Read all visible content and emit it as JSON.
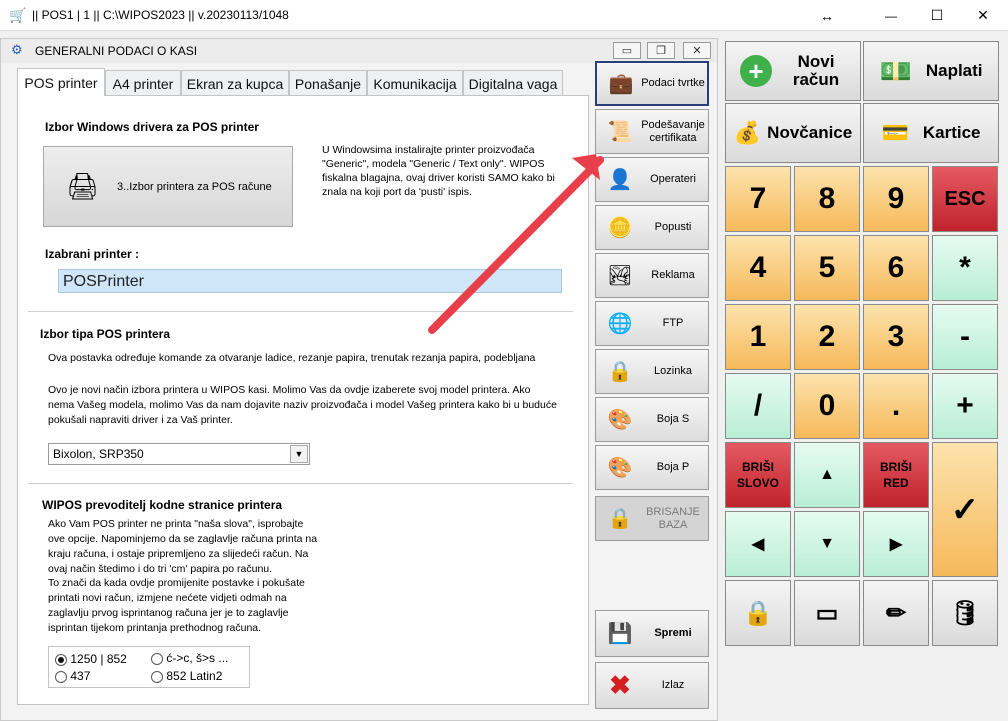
{
  "window": {
    "title": "|| POS1 | 1 || C:\\WIPOS2023 || v.20230113/1048",
    "restore_glyph": "↔",
    "minimize_glyph": "—",
    "maximize_glyph": "☐",
    "close_glyph": "✕"
  },
  "dialog": {
    "title": "GENERALNI PODACI O KASI",
    "tabs": [
      {
        "label": "POS printer"
      },
      {
        "label": "A4 printer"
      },
      {
        "label": "Ekran za kupca"
      },
      {
        "label": "Ponašanje"
      },
      {
        "label": "Komunikacija"
      },
      {
        "label": "Digitalna vaga"
      }
    ],
    "driver_section": {
      "title": "Izbor Windows drivera za POS printer",
      "button_label": "3..Izbor printera za POS račune",
      "note": "U Windowsima instalirajte printer proizvođača \"Generic\", modela \"Generic / Text  only\". WIPOS fiskalna blagajna, ovaj driver koristi SAMO kako bi znala na koji port da 'pusti' ispis."
    },
    "selected_printer": {
      "label": "Izabrani printer :",
      "value": "POSPrinter"
    },
    "type_section": {
      "title": "Izbor tipa POS printera",
      "desc1": "Ova postavka određuje komande za otvaranje ladice, rezanje papira, trenutak rezanja papira, podebljana",
      "desc2": "Ovo je novi način izbora printera u WIPOS kasi. Molimo Vas da ovdje izaberete svoj model printera. Ako nema Vašeg modela, molimo Vas da nam dojavite naziv proizvođača i model Vašeg printera kako bi u buduće pokušali napraviti driver i za Vaš printer.",
      "model_value": "Bixolon, SRP350"
    },
    "codepage_section": {
      "title": "WIPOS prevoditelj kodne stranice printera",
      "desc1": "Ako Vam POS printer ne printa \"naša slova\", isprobajte ove opcije. Napominjemo da se zaglavlje računa printa na kraju računa, i ostaje pripremljeno za slijedeći račun. Na ovaj način štedimo i do tri 'cm' papira po računu.",
      "desc2": "To znači da kada ovdje promijenite postavke i pokušate printati novi račun, izmjene nećete vidjeti odmah na zaglavlju prvog isprintanog računa jer je to zaglavlje isprintan tijekom printanja prethodnog računa.",
      "options": [
        {
          "label": "1250 | 852",
          "checked": true
        },
        {
          "label": "ć->c, š>s ...",
          "checked": false
        },
        {
          "label": "437",
          "checked": false
        },
        {
          "label": "852 Latin2",
          "checked": false
        }
      ]
    }
  },
  "side_buttons": [
    {
      "label": "Podaci tvrtke",
      "icon": "company-icon"
    },
    {
      "label": "Podešavanje certifikata",
      "icon": "certificate-icon"
    },
    {
      "label": "Operateri",
      "icon": "operators-icon"
    },
    {
      "label": "Popusti",
      "icon": "coins-icon"
    },
    {
      "label": "Reklama",
      "icon": "advert-icon"
    },
    {
      "label": "FTP",
      "icon": "ftp-icon"
    },
    {
      "label": "Lozinka",
      "icon": "lock-icon"
    },
    {
      "label": "Boja S",
      "icon": "palette-icon"
    },
    {
      "label": "Boja P",
      "icon": "palette-icon"
    },
    {
      "label": "BRISANJE BAZA",
      "icon": "lock-icon"
    },
    {
      "label": "Spremi",
      "icon": "save-icon"
    },
    {
      "label": "Izlaz",
      "icon": "exit-icon"
    }
  ],
  "keypad": {
    "novi_racun": "Novi račun",
    "naplati": "Naplati",
    "novcanice": "Novčanice",
    "kartice": "Kartice",
    "keys": [
      "7",
      "8",
      "9",
      "ESC",
      "4",
      "5",
      "6",
      "*",
      "1",
      "2",
      "3",
      "-",
      "/",
      "0",
      ".",
      "+"
    ],
    "brisi_slovo": "BRIŠI SLOVO",
    "brisi_red": "BRIŠI RED",
    "confirm_glyph": "✓"
  },
  "colors": {
    "accent_blue": "#1e4fa8",
    "arrow_red": "#e8404a",
    "key_orange": "#f6b95a",
    "key_mint": "#b9eed6",
    "key_red": "#c0222c"
  }
}
